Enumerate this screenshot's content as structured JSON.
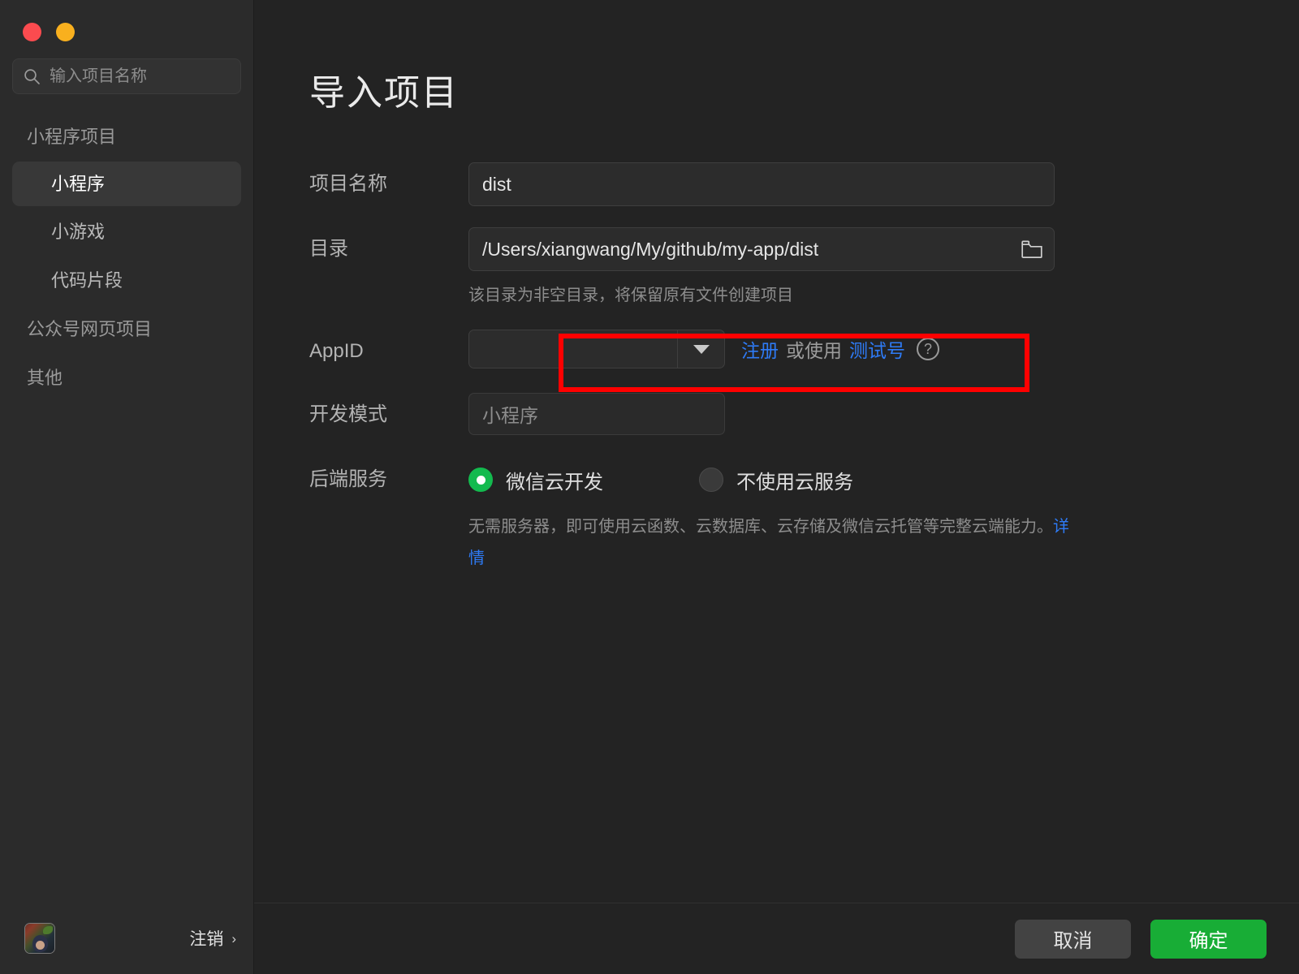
{
  "window": {
    "traffic_lights": [
      {
        "name": "close",
        "color": "#fb4b4f"
      },
      {
        "name": "minimize",
        "color": "#f9b01e"
      }
    ]
  },
  "sidebar": {
    "search": {
      "placeholder": "输入项目名称",
      "value": "",
      "icon": "search-icon"
    },
    "groups": [
      {
        "title": "小程序项目",
        "items": [
          {
            "label": "小程序",
            "selected": true
          },
          {
            "label": "小游戏",
            "selected": false
          },
          {
            "label": "代码片段",
            "selected": false
          }
        ]
      },
      {
        "title": "公众号网页项目",
        "items": []
      },
      {
        "title": "其他",
        "items": []
      }
    ],
    "footer": {
      "avatar_alt": "user-avatar",
      "logout_label": "注销",
      "chevron": "›"
    }
  },
  "main": {
    "title": "导入项目",
    "fields": {
      "project_name": {
        "label": "项目名称",
        "value": "dist",
        "placeholder": ""
      },
      "directory": {
        "label": "目录",
        "value": "/Users/xiangwang/My/github/my-app/dist",
        "placeholder": "",
        "browse_icon": "folder-icon",
        "hint": "该目录为非空目录，将保留原有文件创建项目"
      },
      "appid": {
        "label": "AppID",
        "value": "",
        "placeholder": "",
        "dropdown_icon": "chevron-down-icon",
        "register_link": "注册",
        "or_use_text": "或使用",
        "test_id_link": "测试号",
        "help_icon": "?"
      },
      "dev_mode": {
        "label": "开发模式",
        "value": "小程序",
        "disabled": true
      },
      "backend": {
        "label": "后端服务",
        "options": [
          {
            "label": "微信云开发",
            "selected": true
          },
          {
            "label": "不使用云服务",
            "selected": false
          }
        ],
        "description": "无需服务器，即可使用云函数、云数据库、云存储及微信云托管等完整云端能力。",
        "detail_link": "详情"
      }
    },
    "annotation": {
      "type": "highlight-rectangle",
      "color": "#ff0000",
      "target": "appid-field"
    }
  },
  "footer": {
    "cancel_label": "取消",
    "confirm_label": "确定",
    "confirm_color": "#18ad36"
  }
}
